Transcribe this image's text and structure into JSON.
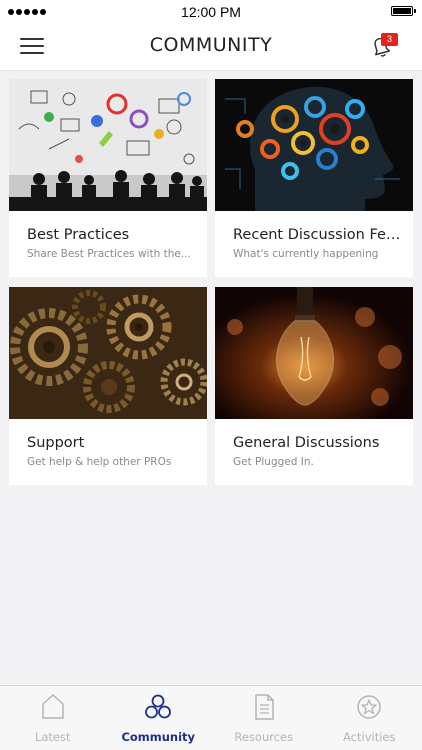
{
  "status_bar": {
    "time": "12:00 PM"
  },
  "header": {
    "title": "COMMUNITY",
    "notification_count": "3",
    "menu_icon": "hamburger-menu-icon",
    "bell_icon": "bell-icon"
  },
  "cards": [
    {
      "title": "Best Practices",
      "subtitle": "Share Best Practices with the...",
      "image": "meeting-ideas-doodle-image"
    },
    {
      "title": "Recent Discussion Fee...",
      "subtitle": "What's currently happening",
      "image": "gear-head-image"
    },
    {
      "title": "Support",
      "subtitle": "Get help & help other PROs",
      "image": "gears-image"
    },
    {
      "title": "General Discussions",
      "subtitle": "Get Plugged In.",
      "image": "light-bulb-image"
    }
  ],
  "tab_bar": {
    "tabs": [
      {
        "label": "Latest",
        "icon": "home-icon",
        "active": false
      },
      {
        "label": "Community",
        "icon": "community-circles-icon",
        "active": true
      },
      {
        "label": "Resources",
        "icon": "document-icon",
        "active": false
      },
      {
        "label": "Activities",
        "icon": "star-badge-icon",
        "active": false
      }
    ]
  },
  "colors": {
    "accent": "#1f2f8a",
    "badge": "#e0251b",
    "inactive_tab": "#b4b4b8",
    "background": "#f2f2f4"
  }
}
